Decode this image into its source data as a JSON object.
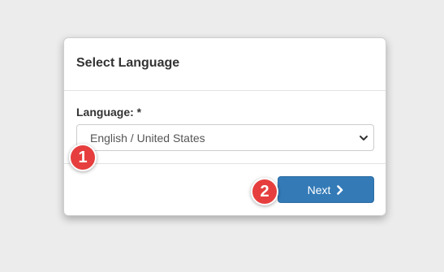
{
  "dialog": {
    "title": "Select Language",
    "language_label": "Language: *",
    "language_value": "English / United States",
    "next_label": "Next"
  },
  "markers": [
    "1",
    "2"
  ],
  "icons": {
    "select_caret": "chevron-down-icon",
    "next_icon": "chevron-right-icon"
  },
  "colors": {
    "primary_button": "#337ab7",
    "marker": "#e63e3e",
    "background": "#ececec"
  }
}
